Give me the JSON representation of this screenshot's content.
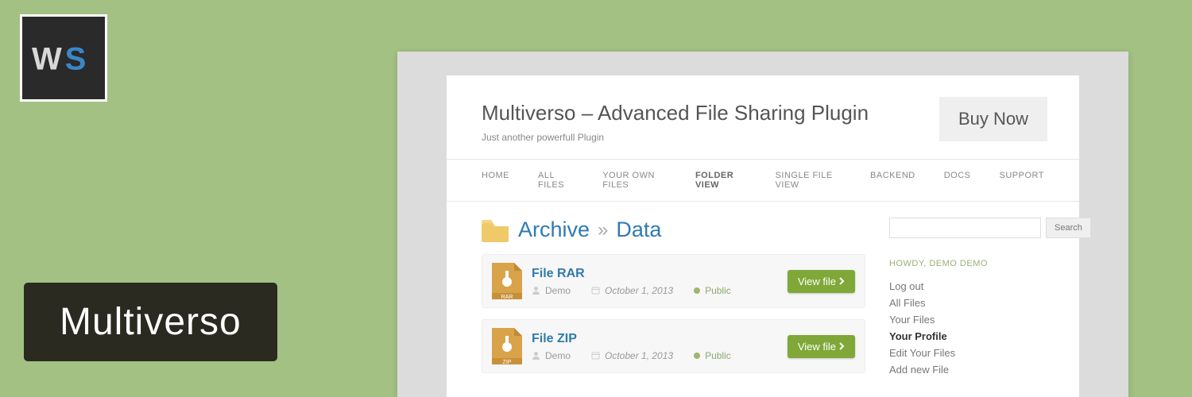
{
  "badge_title": "Multiverso",
  "site": {
    "title": "Multiverso – Advanced File Sharing Plugin",
    "tagline": "Just another powerfull Plugin",
    "buy_label": "Buy Now"
  },
  "nav": {
    "items": [
      "HOME",
      "ALL FILES",
      "YOUR OWN FILES",
      "FOLDER VIEW",
      "SINGLE FILE VIEW",
      "BACKEND",
      "DOCS",
      "SUPPORT"
    ],
    "active_index": 3
  },
  "breadcrumb": {
    "root": "Archive",
    "sep": "»",
    "current": "Data"
  },
  "files": [
    {
      "name": "File RAR",
      "author": "Demo",
      "date": "October 1, 2013",
      "visibility": "Public",
      "ext": "RAR",
      "view_label": "View file"
    },
    {
      "name": "File ZIP",
      "author": "Demo",
      "date": "October 1, 2013",
      "visibility": "Public",
      "ext": "ZIP",
      "view_label": "View file"
    }
  ],
  "sidebar": {
    "search_label": "Search",
    "howdy": "HOWDY, DEMO DEMO",
    "links": [
      "Log out",
      "All Files",
      "Your Files",
      "Your Profile",
      "Edit Your Files",
      "Add new File"
    ],
    "active_index": 3
  }
}
